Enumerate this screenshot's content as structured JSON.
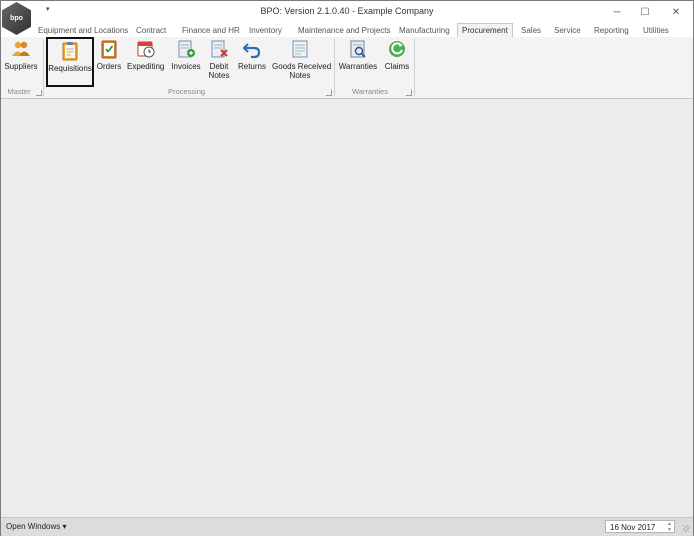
{
  "app": {
    "logo_text": "bpo",
    "title": "BPO: Version 2.1.0.40 - Example Company",
    "qat_glyph": "▾"
  },
  "window_controls": {
    "minimize": "─",
    "maximize": "☐",
    "close": "✕"
  },
  "tabs": [
    {
      "label": "Equipment and Locations"
    },
    {
      "label": "Contract"
    },
    {
      "label": "Finance and HR"
    },
    {
      "label": "Inventory"
    },
    {
      "label": "Maintenance and Projects"
    },
    {
      "label": "Manufacturing"
    },
    {
      "label": "Procurement",
      "active": true
    },
    {
      "label": "Sales"
    },
    {
      "label": "Service"
    },
    {
      "label": "Reporting"
    },
    {
      "label": "Utilities"
    }
  ],
  "ribbon": {
    "groups": [
      {
        "label": "Master"
      },
      {
        "label": "Processing"
      },
      {
        "label": "Warranties"
      }
    ],
    "buttons": [
      {
        "label": "Suppliers",
        "icon": "suppliers-icon"
      },
      {
        "label": "Requisitions",
        "icon": "requisitions-icon",
        "selected": true
      },
      {
        "label": "Orders",
        "icon": "orders-icon"
      },
      {
        "label": "Expediting",
        "icon": "expediting-icon"
      },
      {
        "label": "Invoices",
        "icon": "invoices-icon"
      },
      {
        "label_line1": "Debit",
        "label_line2": "Notes",
        "icon": "debit-notes-icon"
      },
      {
        "label": "Returns",
        "icon": "returns-icon"
      },
      {
        "label_line1": "Goods Received",
        "label_line2": "Notes",
        "icon": "goods-received-notes-icon"
      },
      {
        "label": "Warranties",
        "icon": "warranties-icon"
      },
      {
        "label": "Claims",
        "icon": "claims-icon"
      }
    ]
  },
  "status": {
    "open_windows": "Open Windows",
    "open_windows_arrow": "▾",
    "date": "16 Nov 2017",
    "spin_up": "▲",
    "spin_down": "▼"
  },
  "colors": {
    "selected_outline": "#111111",
    "ribbon_bg": "#f3f3f3",
    "workspace_bg": "#ececec"
  }
}
